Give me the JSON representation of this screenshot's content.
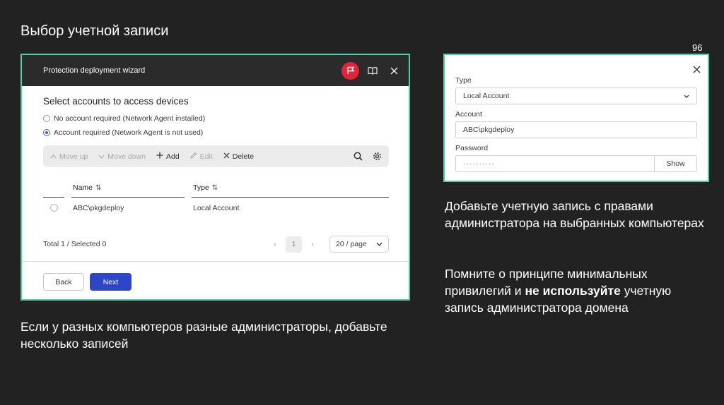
{
  "slide": {
    "title": "Выбор учетной записи",
    "page_number": "96"
  },
  "wizard": {
    "title": "Protection deployment wizard",
    "section_title": "Select accounts to access devices",
    "radio_options": [
      {
        "label": "No account required (Network Agent installed)",
        "checked": false
      },
      {
        "label": "Account required (Network Agent is not used)",
        "checked": true
      }
    ],
    "toolbar": {
      "move_up": "Move up",
      "move_down": "Move down",
      "add": "Add",
      "edit": "Edit",
      "delete": "Delete"
    },
    "table": {
      "columns": [
        "Name",
        "Type"
      ],
      "rows": [
        {
          "name": "ABC\\pkgdeploy",
          "type": "Local Account"
        }
      ]
    },
    "pager": {
      "total": "Total 1 / Selected 0",
      "current_page": "1",
      "page_size": "20 / page"
    },
    "footer": {
      "back": "Back",
      "next": "Next"
    },
    "colors": {
      "accent_border": "#4fd1a6",
      "flag_red": "#e3253b",
      "primary_blue": "#2d46c8"
    }
  },
  "account_panel": {
    "type_label": "Type",
    "type_value": "Local Account",
    "account_label": "Account",
    "account_value": "ABC\\pkgdeploy",
    "password_label": "Password",
    "password_value": "··········",
    "show_label": "Show"
  },
  "captions": {
    "left": "Если у разных компьютеров разные администраторы, добавьте несколько записей",
    "right_1": "Добавьте учетную запись с правами администратора на выбранных компьютерах",
    "right_2_part1": "Помните о принципе минимальных привилегий и ",
    "right_2_bold": "не используйте",
    "right_2_part2": " учетную запись администратора домена"
  }
}
